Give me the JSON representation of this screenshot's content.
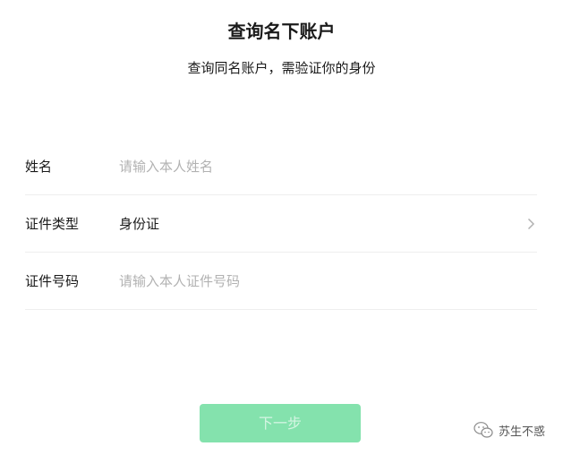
{
  "header": {
    "title": "查询名下账户",
    "subtitle": "查询同名账户，需验证你的身份"
  },
  "form": {
    "name": {
      "label": "姓名",
      "placeholder": "请输入本人姓名",
      "value": ""
    },
    "id_type": {
      "label": "证件类型",
      "value": "身份证",
      "icon": "chevron-right-icon"
    },
    "id_number": {
      "label": "证件号码",
      "placeholder": "请输入本人证件号码",
      "value": ""
    }
  },
  "actions": {
    "next_label": "下一步",
    "next_color": "#84e2ad"
  },
  "watermark": {
    "text": "苏生不惑",
    "icon": "wechat-logo"
  }
}
